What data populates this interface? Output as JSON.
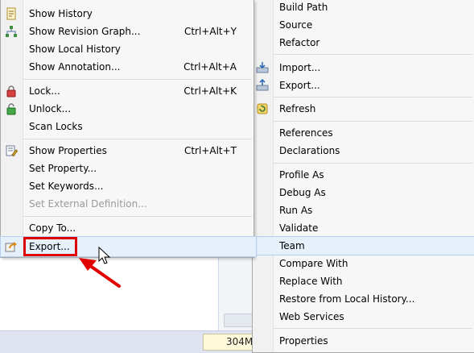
{
  "team_submenu": {
    "items": [
      {
        "label": "Show History",
        "shortcut": "",
        "icon": "history-icon"
      },
      {
        "label": "Show Revision Graph...",
        "shortcut": "Ctrl+Alt+Y",
        "icon": "revision-graph-icon"
      },
      {
        "label": "Show Local History",
        "shortcut": "",
        "icon": ""
      },
      {
        "label": "Show Annotation...",
        "shortcut": "Ctrl+Alt+A",
        "icon": ""
      },
      {
        "label": "Lock...",
        "shortcut": "Ctrl+Alt+K",
        "icon": "lock-icon"
      },
      {
        "label": "Unlock...",
        "shortcut": "",
        "icon": "unlock-icon"
      },
      {
        "label": "Scan Locks",
        "shortcut": "",
        "icon": ""
      },
      {
        "label": "Show Properties",
        "shortcut": "Ctrl+Alt+T",
        "icon": "properties-icon"
      },
      {
        "label": "Set Property...",
        "shortcut": "",
        "icon": ""
      },
      {
        "label": "Set Keywords...",
        "shortcut": "",
        "icon": ""
      },
      {
        "label": "Set External Definition...",
        "shortcut": "",
        "icon": "",
        "disabled": true
      },
      {
        "label": "Copy To...",
        "shortcut": "",
        "icon": ""
      },
      {
        "label": "Export...",
        "shortcut": "",
        "icon": "export-icon",
        "highlighted": true
      }
    ]
  },
  "context_menu": {
    "items": [
      {
        "label": "Build Path"
      },
      {
        "label": "Source"
      },
      {
        "label": "Refactor"
      },
      {
        "label": "Import...",
        "icon": "import-icon"
      },
      {
        "label": "Export...",
        "icon": "export-icon"
      },
      {
        "label": "Refresh",
        "icon": "refresh-icon"
      },
      {
        "label": "References"
      },
      {
        "label": "Declarations"
      },
      {
        "label": "Profile As"
      },
      {
        "label": "Debug As"
      },
      {
        "label": "Run As"
      },
      {
        "label": "Validate"
      },
      {
        "label": "Team",
        "highlighted": true
      },
      {
        "label": "Compare With"
      },
      {
        "label": "Replace With"
      },
      {
        "label": "Restore from Local History..."
      },
      {
        "label": "Web Services"
      },
      {
        "label": "Properties"
      }
    ]
  },
  "status_bar": {
    "heap_text": "304M"
  },
  "annotation": {
    "color": "#e00000",
    "target": "Export..."
  }
}
